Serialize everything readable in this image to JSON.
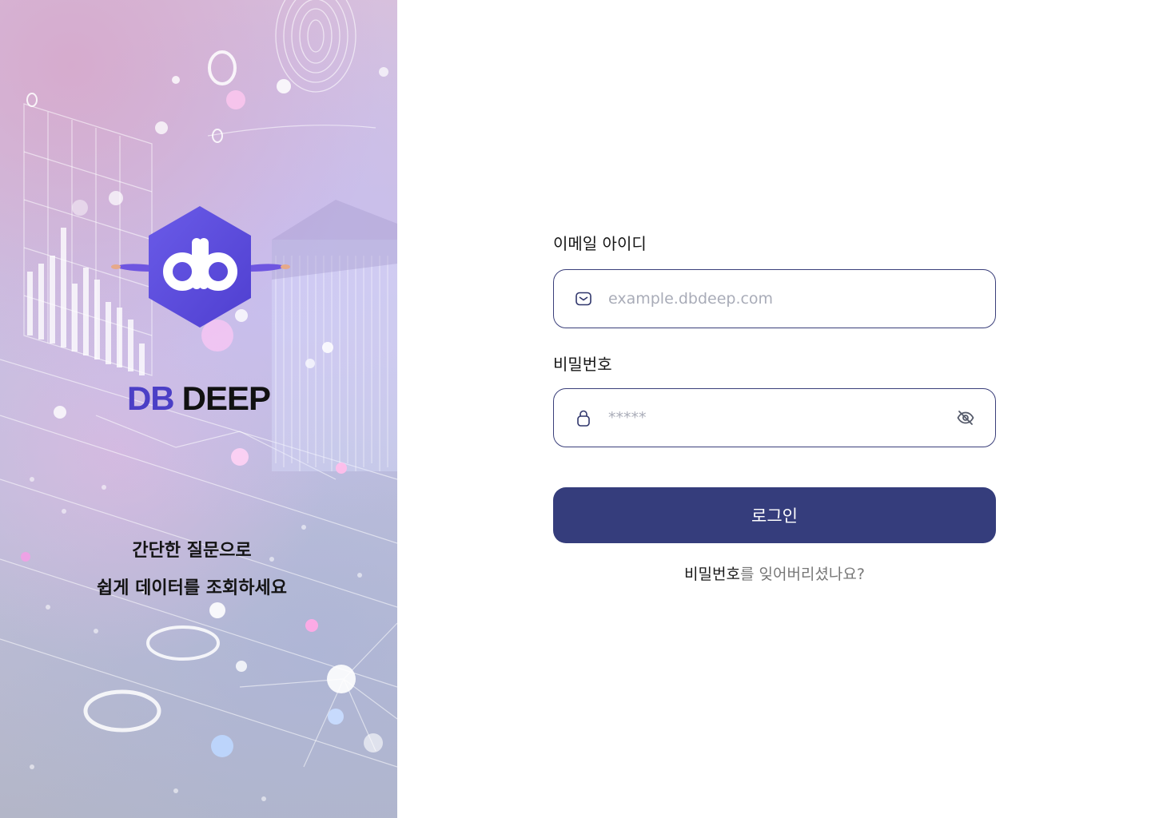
{
  "left_panel": {
    "brand_db": "DB",
    "brand_deep": "DEEP",
    "logo_mark": "db",
    "tagline_line1": "간단한 질문으로",
    "tagline_line2": "쉽게 데이터를 조회하세요",
    "brand_color": "#4b3fc6"
  },
  "form": {
    "email_label": "이메일 아이디",
    "email_placeholder": "example.dbdeep.com",
    "email_icon": "mail-icon",
    "password_label": "비밀번호",
    "password_placeholder": "*****",
    "password_icon": "lock-icon",
    "visibility_icon": "eye-off-icon",
    "login_label": "로그인",
    "login_color": "#353d7c",
    "forgot_strong": "비밀번호",
    "forgot_rest": "를 잊어버리셨나요?"
  }
}
